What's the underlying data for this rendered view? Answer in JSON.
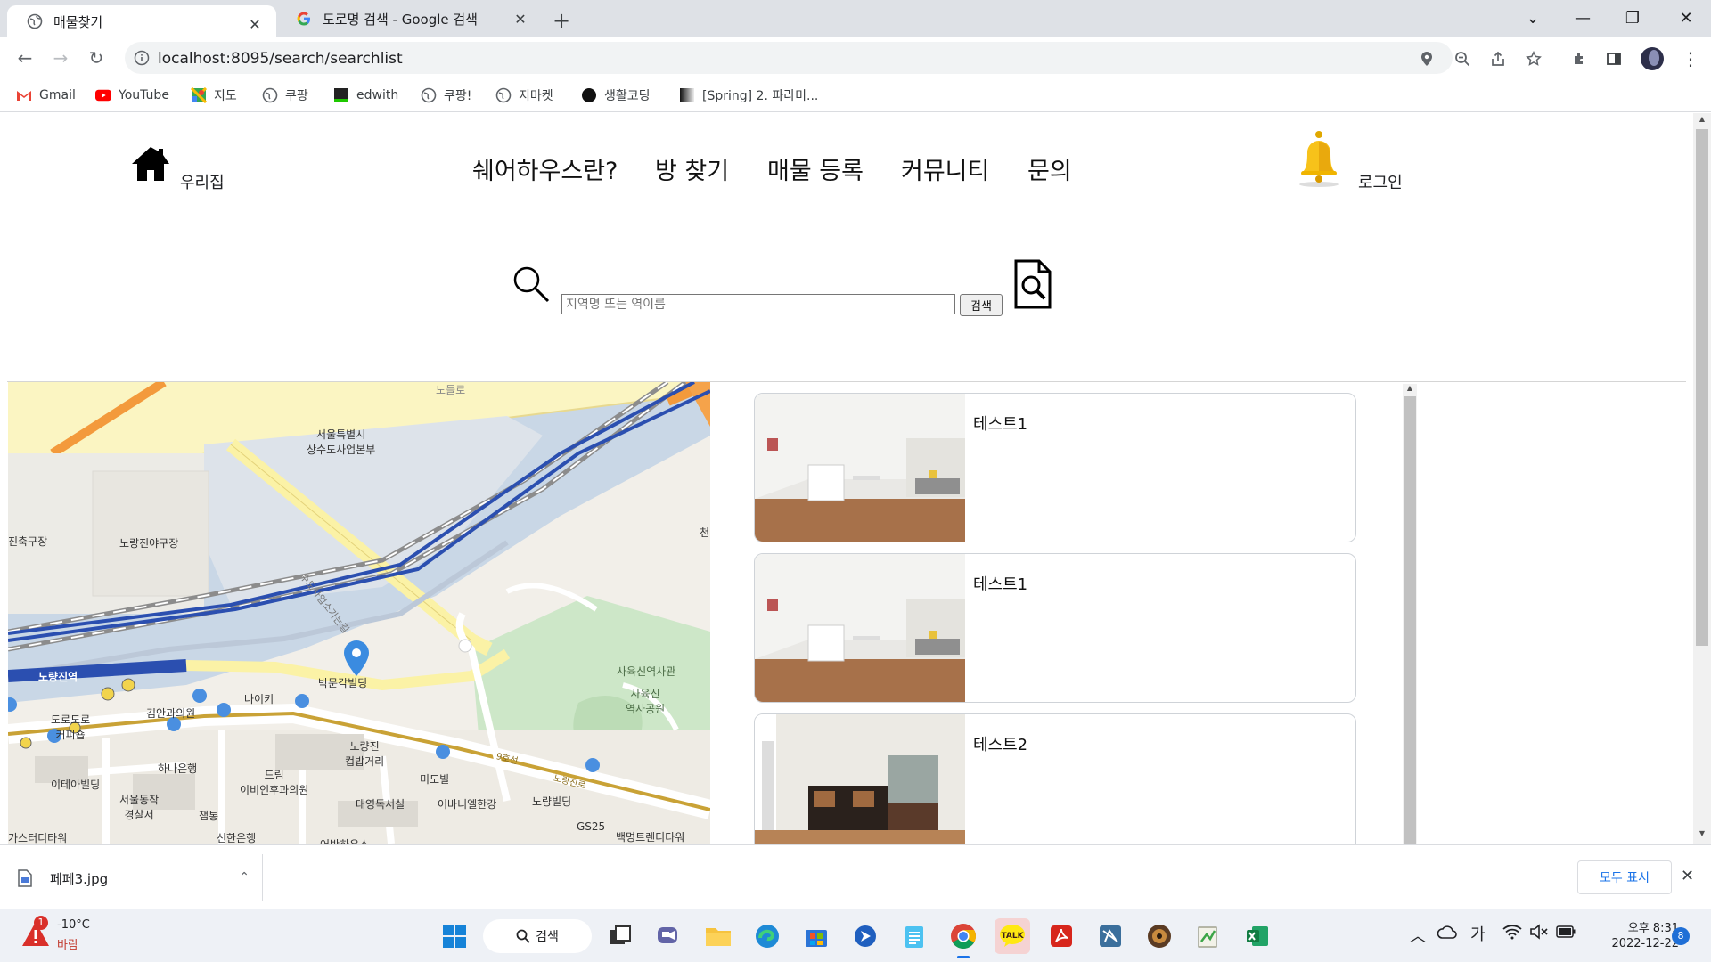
{
  "browser": {
    "tabs": [
      {
        "title": "매물찾기",
        "active": true
      },
      {
        "title": "도로명 검색 - Google 검색",
        "active": false
      }
    ],
    "url": "localhost:8095/search/searchlist",
    "bookmarks": [
      "Gmail",
      "YouTube",
      "지도",
      "쿠팡",
      "edwith",
      "쿠팡!",
      "지마켓",
      "생활코딩",
      "[Spring] 2. 파라미..."
    ]
  },
  "site": {
    "logo_text": "우리집",
    "nav": [
      "쉐어하우스란?",
      "방 찾기",
      "매물 등록",
      "커뮤니티",
      "문의"
    ],
    "login": "로그인",
    "search": {
      "placeholder": "지역명 또는 역이름",
      "button": "검색"
    }
  },
  "map": {
    "labels": {
      "road_top": "노들로",
      "office": "서울특별시\n상수도사업본부",
      "stadium_left": "진축구장",
      "stadium": "노량진야구장",
      "right_edge": "천",
      "road_diag": "수도사업소가는길",
      "station": "노량진역",
      "building1": "박문각빌딩",
      "nayiki": "나이키",
      "kiman": "김안과의원",
      "dorodoro": "도로도로\n커피숍",
      "yuksin": "사육신역사관",
      "yuksin_park": "사육신\n역사공원",
      "cupbap": "노량진\n컵밥거리",
      "hana": "하나은행",
      "theia": "이테아빌딩",
      "police": "서울동작\n경찰서",
      "drim": "드림\n이비인후과의원",
      "mido": "미도빌",
      "daeyoung": "대영독서실",
      "abinu": "어바니엘한강",
      "noryang_bldg": "노량빌딩",
      "jamtong": "잼통",
      "shinhan": "신한은행",
      "gs25": "GS25",
      "paekmyeon": "백명트렌디타워",
      "gaster": "가스터디타워",
      "abhouse": "어반하우스",
      "road_9": "9호선",
      "road_noryang": "노량진로"
    }
  },
  "listings": [
    {
      "title": "테스트1",
      "image": "room-1"
    },
    {
      "title": "테스트1",
      "image": "room-1"
    },
    {
      "title": "테스트2",
      "image": "room-2"
    }
  ],
  "download": {
    "filename": "페페3.jpg",
    "show_all": "모두 표시"
  },
  "taskbar": {
    "weather_temp": "-10°C",
    "weather_desc": "바람",
    "weather_badge": "1",
    "search": "검색",
    "ime": "가",
    "time": "오후 8:31",
    "date": "2022-12-22",
    "notif_count": "8"
  }
}
